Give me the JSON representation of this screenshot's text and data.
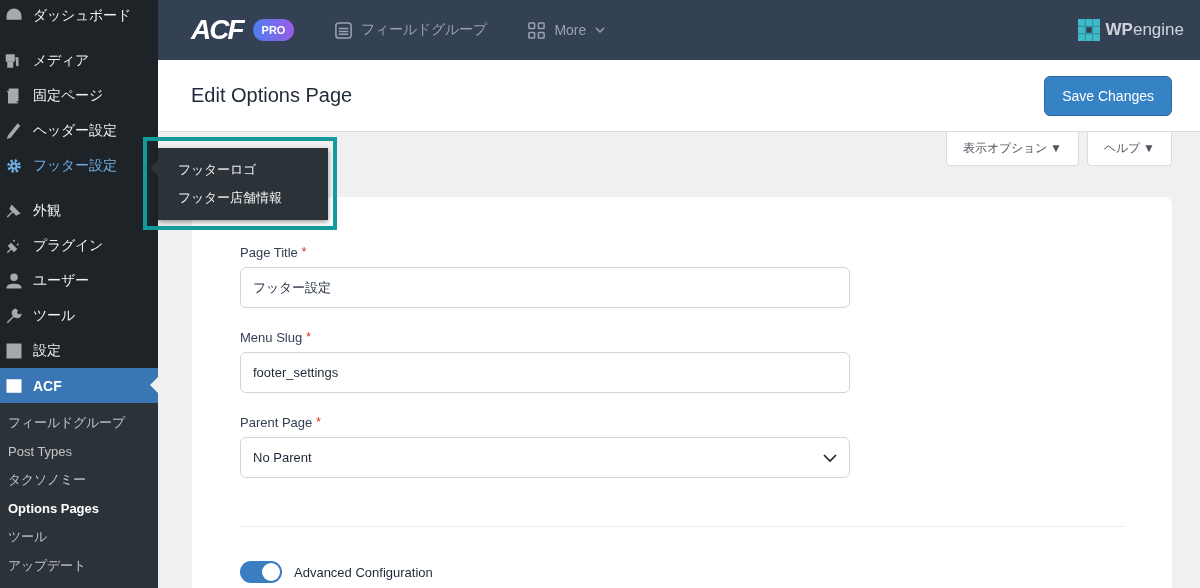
{
  "sidebar": {
    "menu_groups": [
      [
        {
          "label": "ダッシュボード",
          "selected": false,
          "hovered": false
        }
      ],
      [
        {
          "label": "メディア",
          "selected": false,
          "hovered": false
        },
        {
          "label": "固定ページ",
          "selected": false,
          "hovered": false
        },
        {
          "label": "ヘッダー設定",
          "selected": false,
          "hovered": false
        },
        {
          "label": "フッター設定",
          "selected": false,
          "hovered": true
        }
      ],
      [
        {
          "label": "外観",
          "selected": false,
          "hovered": false
        },
        {
          "label": "プラグイン",
          "selected": false,
          "hovered": false
        },
        {
          "label": "ユーザー",
          "selected": false,
          "hovered": false
        },
        {
          "label": "ツール",
          "selected": false,
          "hovered": false
        },
        {
          "label": "設定",
          "selected": false,
          "hovered": false
        },
        {
          "label": "ACF",
          "selected": true,
          "hovered": false
        }
      ]
    ],
    "submenu": [
      {
        "label": "フィールドグループ",
        "selected": false
      },
      {
        "label": "Post Types",
        "selected": false
      },
      {
        "label": "タクソノミー",
        "selected": false
      },
      {
        "label": "Options Pages",
        "selected": true
      },
      {
        "label": "ツール",
        "selected": false
      },
      {
        "label": "アップデート",
        "selected": false
      }
    ],
    "flyout": [
      "フッターロゴ",
      "フッター店舗情報"
    ]
  },
  "topbar": {
    "logo": "ACF",
    "badge": "PRO",
    "nav": [
      {
        "label": "フィールドグループ",
        "kind": "list"
      },
      {
        "label": "More",
        "kind": "more"
      }
    ],
    "brand": "**WP**engine"
  },
  "header": {
    "title": "Edit Options Page",
    "save_button": "Save Changes"
  },
  "screen_tabs": [
    "表示オプション ▼",
    "ヘルプ ▼"
  ],
  "form": {
    "fields": [
      {
        "label": "Page Title",
        "required_mark": "*",
        "kind": "text",
        "value": "フッター設定"
      },
      {
        "label": "Menu Slug",
        "required_mark": "*",
        "kind": "text",
        "value": "footer_settings"
      },
      {
        "label": "Parent Page",
        "required_mark": "*",
        "kind": "select",
        "value": "No Parent"
      }
    ],
    "toggle": {
      "label": "Advanced Configuration",
      "on": true
    }
  }
}
